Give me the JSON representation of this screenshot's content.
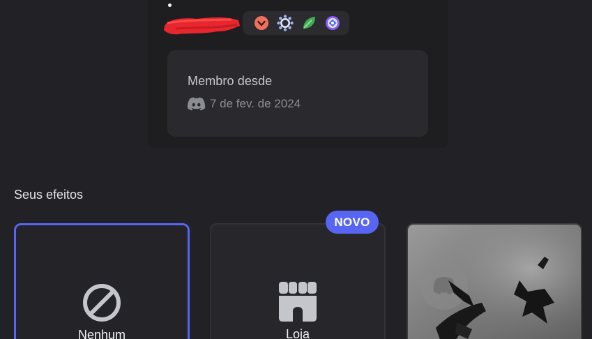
{
  "profile": {
    "member_since_title": "Membro desde",
    "member_since_date": "7 de fev. de 2024",
    "badges": [
      "nitro-boost-badge",
      "server-booster-badge",
      "leaf-badge",
      "quest-badge"
    ]
  },
  "effects": {
    "section_title": "Seus efeitos",
    "new_badge": "NOVO",
    "tiles": [
      {
        "label": "Nenhum",
        "icon": "none-icon",
        "selected": true
      },
      {
        "label": "Loja",
        "icon": "shop-icon",
        "selected": false
      },
      {
        "label": "",
        "icon": "effect-preview",
        "selected": false
      }
    ]
  },
  "colors": {
    "background": "#222226",
    "accent": "#5865f2",
    "card": "#1e1e21",
    "redaction": "#e8262e"
  }
}
